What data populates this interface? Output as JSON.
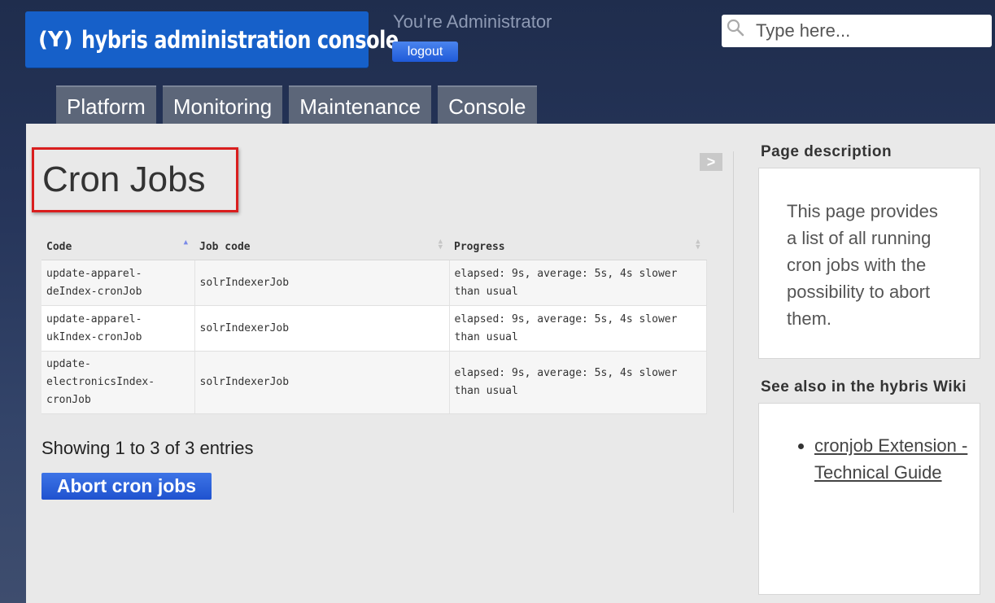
{
  "header": {
    "logo_mark": "(Y)",
    "logo_text": "hybris administration console",
    "user_text": "You're Administrator",
    "logout_label": "logout",
    "search_placeholder": "Type here..."
  },
  "nav": {
    "tabs": [
      {
        "label": "Platform"
      },
      {
        "label": "Monitoring"
      },
      {
        "label": "Maintenance"
      },
      {
        "label": "Console"
      }
    ]
  },
  "main": {
    "title": "Cron Jobs",
    "collapse_label": ">",
    "table": {
      "headers": [
        "Code",
        "Job code",
        "Progress"
      ],
      "rows": [
        {
          "code": "update-apparel-deIndex-cronJob",
          "job_code": "solrIndexerJob",
          "progress": "elapsed: 9s, average: 5s, 4s slower than usual"
        },
        {
          "code": "update-apparel-ukIndex-cronJob",
          "job_code": "solrIndexerJob",
          "progress": "elapsed: 9s, average: 5s, 4s slower than usual"
        },
        {
          "code": "update-electronicsIndex-cronJob",
          "job_code": "solrIndexerJob",
          "progress": "elapsed: 9s, average: 5s, 4s slower than usual"
        }
      ]
    },
    "info": "Showing 1 to 3 of 3 entries",
    "abort_label": "Abort cron jobs"
  },
  "sidebar": {
    "description_heading": "Page description",
    "description_text": "This page provides a list of all running cron jobs with the possibility to abort them.",
    "see_also_heading": "See also in the hybris Wiki",
    "see_also_links": [
      {
        "label": "cronjob Extension - Technical Guide"
      }
    ]
  },
  "colors": {
    "brand": "#1660c9",
    "button": "#1f52cf",
    "highlight": "#d91e1e"
  }
}
